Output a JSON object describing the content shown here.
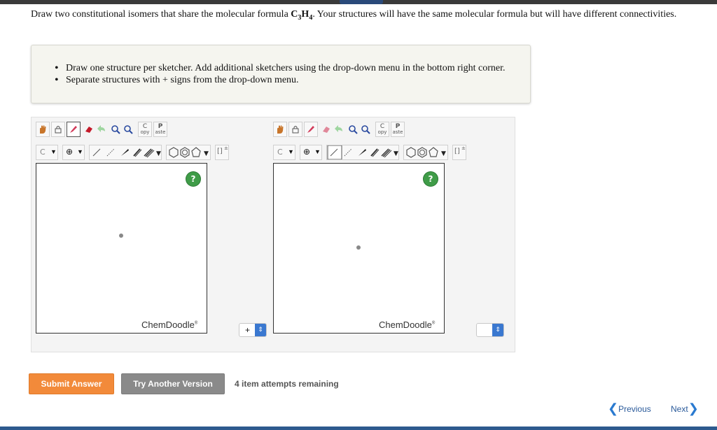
{
  "question": {
    "text_before": "Draw two constitutional isomers that share the molecular formula ",
    "formula_c": "C",
    "formula_c_sub": "3",
    "formula_h": "H",
    "formula_h_sub": "4",
    "text_after": ". Your structures will have the same molecular formula but will have different connectivities."
  },
  "instructions": [
    "Draw one structure per sketcher. Add additional sketchers using the drop-down menu in the bottom right corner.",
    "Separate structures with + signs from the drop-down menu."
  ],
  "toolbar": {
    "copy_top": "C",
    "copy_bottom": "opy",
    "paste_top": "P",
    "paste_bottom": "aste",
    "element_label": "C",
    "charge_symbol": "⊕",
    "ring_bracket": "[]",
    "ring_sup": "±"
  },
  "sketchers": [
    {
      "brand": "ChemDoodle",
      "reg": "®",
      "help": "?"
    },
    {
      "brand": "ChemDoodle",
      "reg": "®",
      "help": "?"
    }
  ],
  "separators": [
    {
      "value": "+"
    },
    {
      "value": ""
    }
  ],
  "buttons": {
    "submit": "Submit Answer",
    "try_another": "Try Another Version"
  },
  "attempts": "4 item attempts remaining",
  "nav": {
    "previous": "Previous",
    "next": "Next"
  },
  "colors": {
    "submit": "#f28a3a",
    "try_another": "#8a8a8a",
    "help_icon": "#3f9c48",
    "select_arrow": "#3a78d0",
    "nav_link": "#2a5a9a"
  }
}
